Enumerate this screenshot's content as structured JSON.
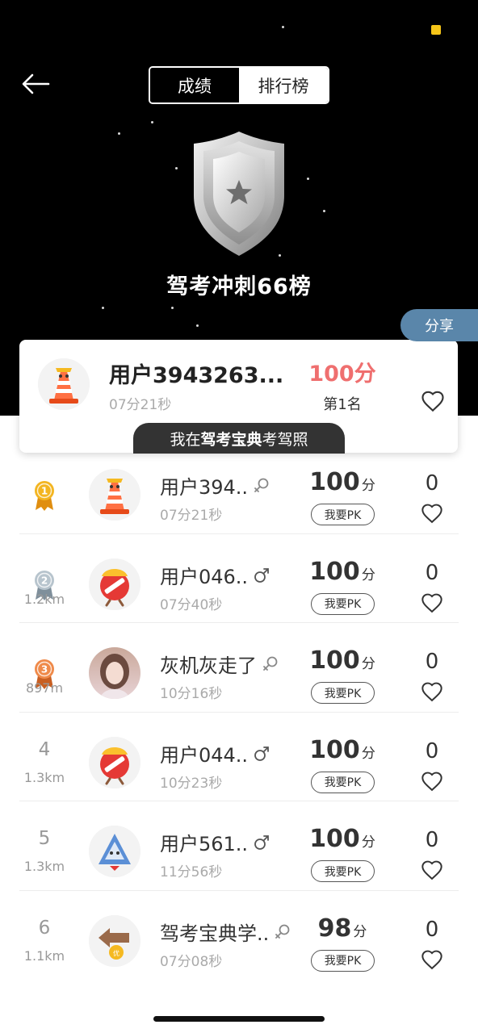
{
  "header": {
    "tabs": [
      {
        "label": "成绩",
        "active": true
      },
      {
        "label": "排行榜",
        "active": false
      }
    ],
    "board_title": "驾考冲刺66榜",
    "share_label": "分享",
    "status_indicator_color": "#f5c518"
  },
  "my_card": {
    "name": "用户3943263...",
    "time": "07分21秒",
    "score": "100分",
    "rank": "第1名",
    "promo_prefix": "我在",
    "promo_brand": "驾考宝典",
    "promo_suffix": "考驾照",
    "score_color": "#ef6f6f"
  },
  "ranking": {
    "pk_label": "我要PK",
    "unit": "分",
    "rows": [
      {
        "rank": "1",
        "distance": "",
        "medal": "gold",
        "name": "用户394..",
        "gender": "unknown",
        "time": "07分21秒",
        "score": "100",
        "likes": "0",
        "avatar": "cone-mascot-icon"
      },
      {
        "rank": "2",
        "distance": "1.2km",
        "medal": "silver",
        "name": "用户046..",
        "gender": "male",
        "time": "07分40秒",
        "score": "100",
        "likes": "0",
        "avatar": "no-entry-mascot-icon"
      },
      {
        "rank": "3",
        "distance": "897m",
        "medal": "bronze",
        "name": "灰机灰走了",
        "gender": "unknown",
        "time": "10分16秒",
        "score": "100",
        "likes": "0",
        "avatar": "photo-avatar"
      },
      {
        "rank": "4",
        "distance": "1.3km",
        "medal": "",
        "name": "用户044..",
        "gender": "male",
        "time": "10分23秒",
        "score": "100",
        "likes": "0",
        "avatar": "no-entry-mascot-icon"
      },
      {
        "rank": "5",
        "distance": "1.3km",
        "medal": "",
        "name": "用户561..",
        "gender": "male",
        "time": "11分56秒",
        "score": "100",
        "likes": "0",
        "avatar": "warning-sign-mascot-icon"
      },
      {
        "rank": "6",
        "distance": "1.1km",
        "medal": "",
        "name": "驾考宝典学..",
        "gender": "unknown",
        "time": "07分08秒",
        "score": "98",
        "likes": "0",
        "avatar": "arrow-sign-mascot-icon"
      }
    ]
  },
  "colors": {
    "hero_bg": "#000000",
    "share_bg": "#5a86aa",
    "gold": "#f3b521",
    "silver": "#9aa9b4",
    "bronze": "#e07a3c"
  }
}
